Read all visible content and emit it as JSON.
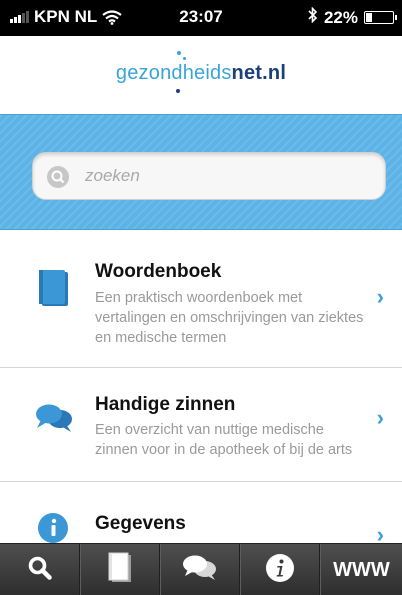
{
  "status_bar": {
    "carrier": "KPN NL",
    "time": "23:07",
    "battery": "22%"
  },
  "header": {
    "logo_part1": "gezondheids",
    "logo_part2": "net.nl"
  },
  "search": {
    "placeholder": "zoeken"
  },
  "list": {
    "items": [
      {
        "title": "Woordenboek",
        "description": "Een praktisch woordenboek met vertalingen en omschrijvingen van ziektes en medische termen",
        "icon": "book-icon"
      },
      {
        "title": "Handige zinnen",
        "description": "Een overzicht van nuttige medische zinnen voor in de apotheek of bij de arts",
        "icon": "chat-bubbles-icon"
      },
      {
        "title": "Gegevens",
        "description": "",
        "icon": "info-icon"
      }
    ]
  },
  "tab_bar": {
    "tabs": [
      {
        "icon": "search-icon"
      },
      {
        "icon": "book-icon"
      },
      {
        "icon": "chat-bubbles-icon"
      },
      {
        "icon": "info-icon"
      },
      {
        "label": "WWW"
      }
    ]
  },
  "colors": {
    "accent": "#3a9fdc",
    "search_band": "#5bb3e6",
    "logo_light": "#3aa4d9",
    "logo_dark": "#1d3f7a"
  }
}
